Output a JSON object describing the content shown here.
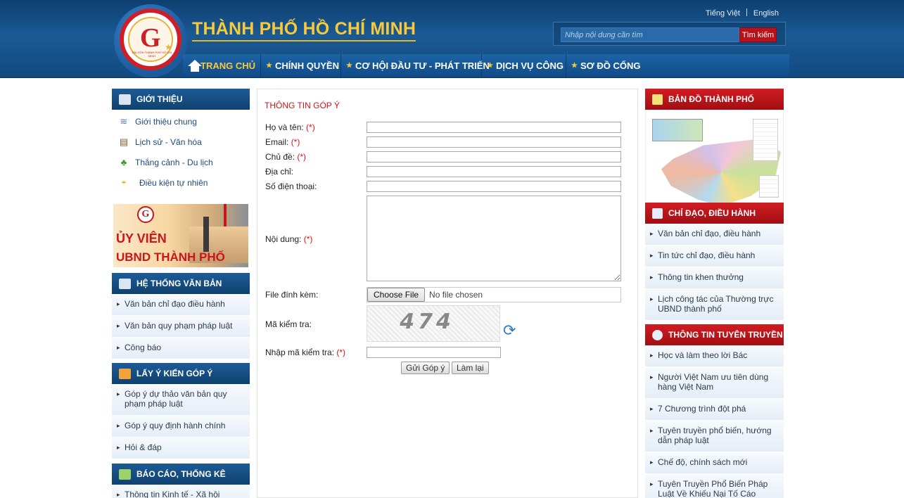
{
  "header": {
    "site_title": "THÀNH PHỐ HỒ CHÍ MINH",
    "logo_caption": "SÀI GÒN THÀNH PHỐ HỒ CHÍ MINH",
    "lang_vi": "Tiếng Việt",
    "lang_en": "English",
    "search_placeholder": "Nhập nội dung cần tìm",
    "search_button": "Tìm kiếm"
  },
  "nav": [
    {
      "label": "TRANG CHỦ"
    },
    {
      "label": "CHÍNH QUYỀN"
    },
    {
      "label": "CƠ HỘI ĐẦU TƯ - PHÁT TRIỂN"
    },
    {
      "label": "DỊCH VỤ CÔNG"
    },
    {
      "label": "SƠ ĐỒ CỔNG"
    }
  ],
  "left": {
    "intro": {
      "title": "GIỚI THIỆU",
      "items": [
        "Giới thiệu chung",
        "Lịch sử - Văn hóa",
        "Thắng cảnh - Du lịch",
        "Điều kiện tự nhiên"
      ]
    },
    "banner": {
      "line1": "ỦY VIÊN",
      "line2": "UBND THÀNH PHỐ"
    },
    "docs": {
      "title": "HỆ THỐNG VĂN BẢN",
      "items": [
        "Văn bản chỉ đạo điều hành",
        "Văn bản quy phạm pháp luật",
        "Công báo"
      ]
    },
    "feedback": {
      "title": "LẤY Ý KIẾN GÓP Ý",
      "items": [
        "Góp ý dự thảo văn bản quy phạm pháp luật",
        "Góp ý quy định hành chính",
        "Hỏi & đáp"
      ]
    },
    "reports": {
      "title": "BÁO CÁO, THỐNG KÊ",
      "items": [
        "Thông tin Kinh tế - Xã hội"
      ]
    }
  },
  "form": {
    "title": "THÔNG TIN GÓP Ý",
    "required_mark": "(*)",
    "fullname_label": "Họ và tên:",
    "email_label": "Email:",
    "subject_label": "Chủ đề:",
    "address_label": "Địa chỉ:",
    "phone_label": "Số điện thoại:",
    "content_label": "Nội dung:",
    "attach_label": "File đính kèm:",
    "choose_file": "Choose File",
    "no_file": "No file chosen",
    "captcha_label": "Mã kiểm tra:",
    "captcha_text": "474",
    "captcha_input_label": "Nhập mã kiểm tra:",
    "submit": "Gửi Góp ý",
    "reset": "Làm lại"
  },
  "right": {
    "map": {
      "title": "BẢN ĐỒ THÀNH PHỐ"
    },
    "direction": {
      "title": "CHỈ ĐẠO, ĐIỀU HÀNH",
      "items": [
        "Văn bản chỉ đạo, điều hành",
        "Tin tức chỉ đạo, điều hành",
        "Thông tin khen thưởng",
        "Lịch công tác của Thường trực UBND thành phố"
      ]
    },
    "propaganda": {
      "title": "THÔNG TIN TUYÊN TRUYỀN",
      "items": [
        "Học và làm theo lời Bác",
        "Người Việt Nam ưu tiên dùng hàng Việt Nam",
        "7 Chương trình đột phá",
        "Tuyên truyền phổ biến, hướng dẫn pháp luật",
        "Chế độ, chính sách mới",
        "Tuyên Truyền Phổ Biến Pháp Luật Về Khiếu Nại Tố Cáo"
      ]
    }
  },
  "colors": {
    "brand_blue": "#1a5a94",
    "accent_gold": "#f7c93b",
    "accent_red": "#c8161d"
  }
}
